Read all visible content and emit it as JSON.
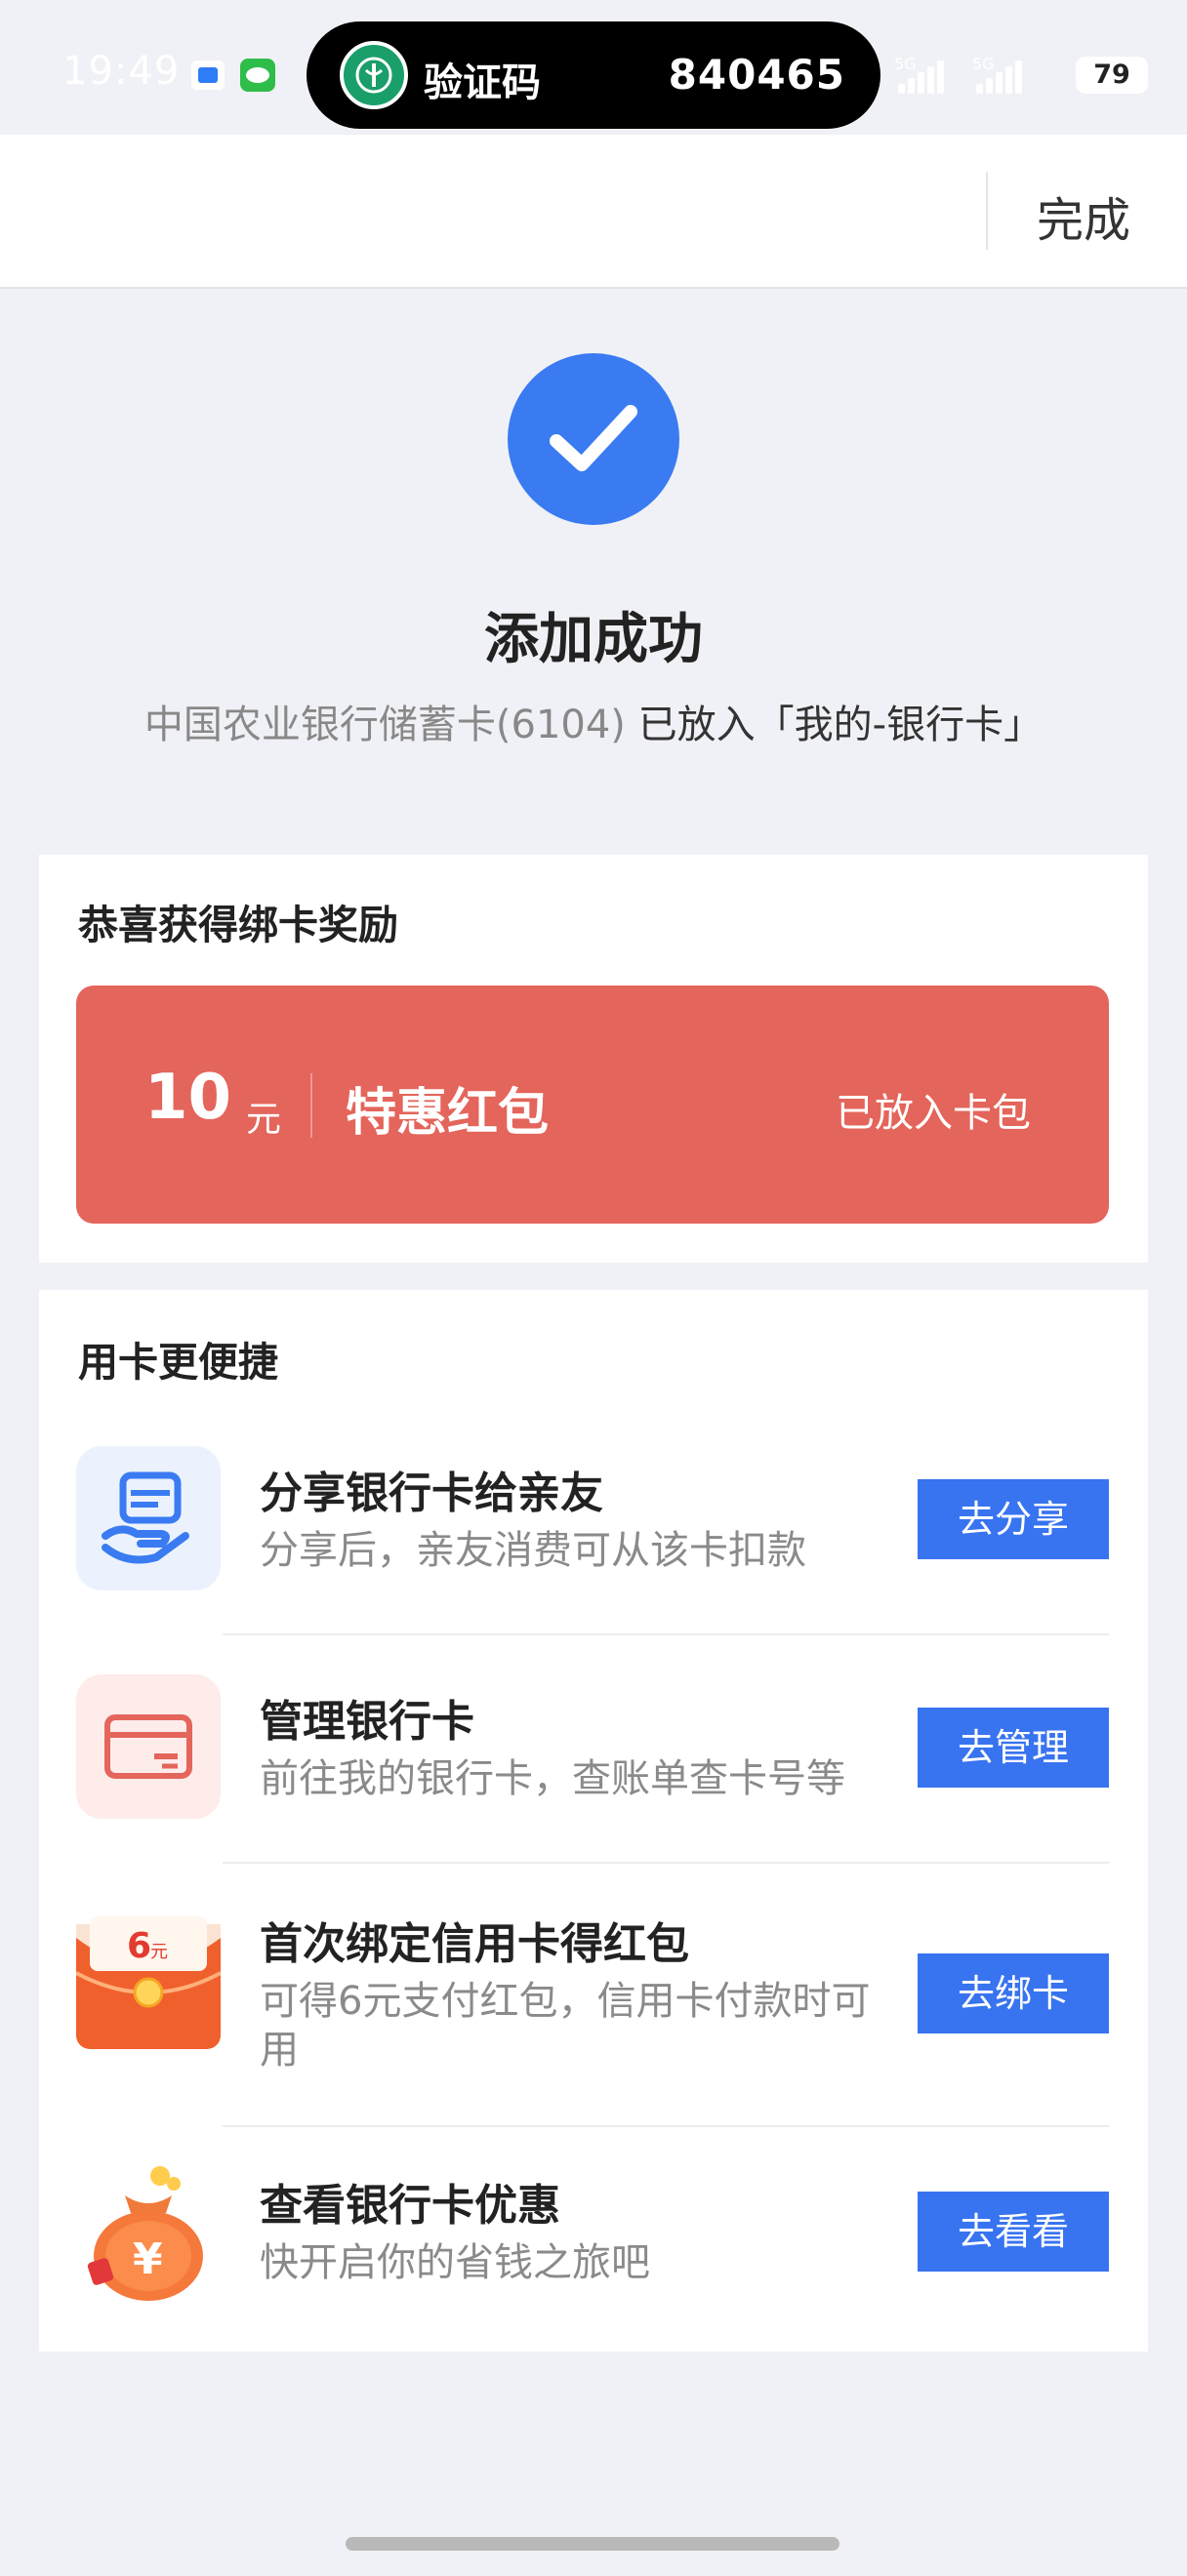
{
  "status_bar": {
    "time": "19:49",
    "notification": {
      "label": "验证码",
      "code": "840465"
    },
    "signal1": "5G",
    "signal2": "5G",
    "battery": "79"
  },
  "header": {
    "done_label": "完成"
  },
  "success": {
    "title": "添加成功",
    "card_name": "中国农业银行储蓄卡(6104)",
    "placed_text": " 已放入「我的-银行卡」"
  },
  "reward": {
    "title": "恭喜获得绑卡奖励",
    "amount": "10",
    "unit": "元",
    "name": "特惠红包",
    "status": "已放入卡包"
  },
  "features": {
    "title": "用卡更便捷",
    "items": [
      {
        "title": "分享银行卡给亲友",
        "subtitle": "分享后，亲友消费可从该卡扣款",
        "button": "去分享",
        "icon": "share-card-hand-icon"
      },
      {
        "title": "管理银行卡",
        "subtitle": "前往我的银行卡，查账单查卡号等",
        "button": "去管理",
        "icon": "bank-card-icon"
      },
      {
        "title": "首次绑定信用卡得红包",
        "subtitle": "可得6元支付红包，信用卡付款时可用",
        "button": "去绑卡",
        "icon": "red-envelope-icon",
        "badge": "6",
        "badge_unit": "元"
      },
      {
        "title": "查看银行卡优惠",
        "subtitle": "快开启你的省钱之旅吧",
        "button": "去看看",
        "icon": "money-bag-icon",
        "badge": "¥"
      }
    ]
  }
}
